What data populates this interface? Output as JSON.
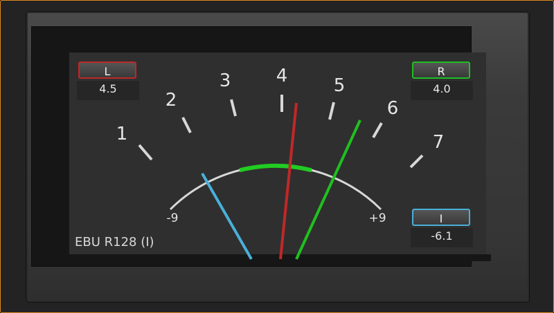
{
  "meter": {
    "standard_label": "EBU R128 (I)",
    "scale": {
      "numbers": [
        "1",
        "2",
        "3",
        "4",
        "5",
        "6",
        "7"
      ],
      "min_label": "-9",
      "max_label": "+9",
      "min": -9,
      "max": 9
    },
    "channels": {
      "left": {
        "label": "L",
        "value": "4.5",
        "color": "#c02828"
      },
      "right": {
        "label": "R",
        "value": "4.0",
        "color": "#20c020"
      },
      "integrated": {
        "label": "I",
        "value": "-6.1",
        "color": "#4ab0d8"
      }
    },
    "needles": {
      "left_color": "#c02828",
      "right_color": "#20c020",
      "integrated_color": "#4ab0d8"
    },
    "arc_color": "#d8d8d8",
    "arc_highlight_color": "#22cc22"
  }
}
